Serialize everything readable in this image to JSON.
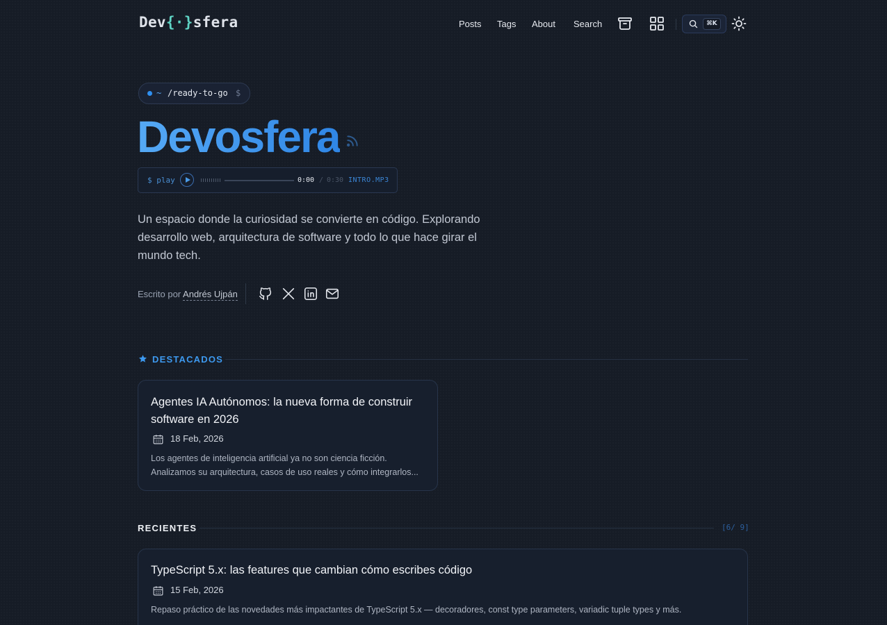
{
  "header": {
    "logo": {
      "prefix": "Dev",
      "open": "{",
      "dot": "·",
      "close": "}",
      "suffix": "sfera"
    },
    "nav": [
      "Posts",
      "Tags",
      "About",
      "Search"
    ],
    "search_shortcut": "⌘K",
    "icons": [
      "archive-icon",
      "grid-icon",
      "search-icon",
      "sun-icon"
    ]
  },
  "hero": {
    "path_tilde": "~",
    "path": "/ready-to-go",
    "prompt": "$",
    "title": "Devosfera",
    "player": {
      "command": "$ play",
      "current": "0:00",
      "separator": "/",
      "duration": "0:30",
      "file": "INTRO.MP3",
      "progress": 0
    },
    "description": "Un espacio donde la curiosidad se convierte en código. Explorando desarrollo web, arquitectura de software y todo lo que hace girar el mundo tech.",
    "author_label": "Escrito por",
    "author_name": "Andrés Ujpán",
    "social": [
      "github-icon",
      "x-icon",
      "linkedin-icon",
      "mail-icon"
    ]
  },
  "featured": {
    "title": "DESTACADOS",
    "posts": [
      {
        "title": "Agentes IA Autónomos: la nueva forma de construir software en 2026",
        "date": "18 Feb, 2026",
        "excerpt": "Los agentes de inteligencia artificial ya no son ciencia ficción. Analizamos su arquitectura, casos de uso reales y cómo integrarlos..."
      }
    ]
  },
  "recent": {
    "title": "RECIENTES",
    "counter": "[6/ 9]",
    "posts": [
      {
        "title": "TypeScript 5.x: las features que cambian cómo escribes código",
        "date": "15 Feb, 2026",
        "excerpt": "Repaso práctico de las novedades más impactantes de TypeScript 5.x — decoradores, const type parameters, variadic tuple types y más."
      }
    ]
  },
  "colors": {
    "accent": "#3d99ef",
    "teal": "#5fd3c4",
    "background": "#161c26"
  }
}
